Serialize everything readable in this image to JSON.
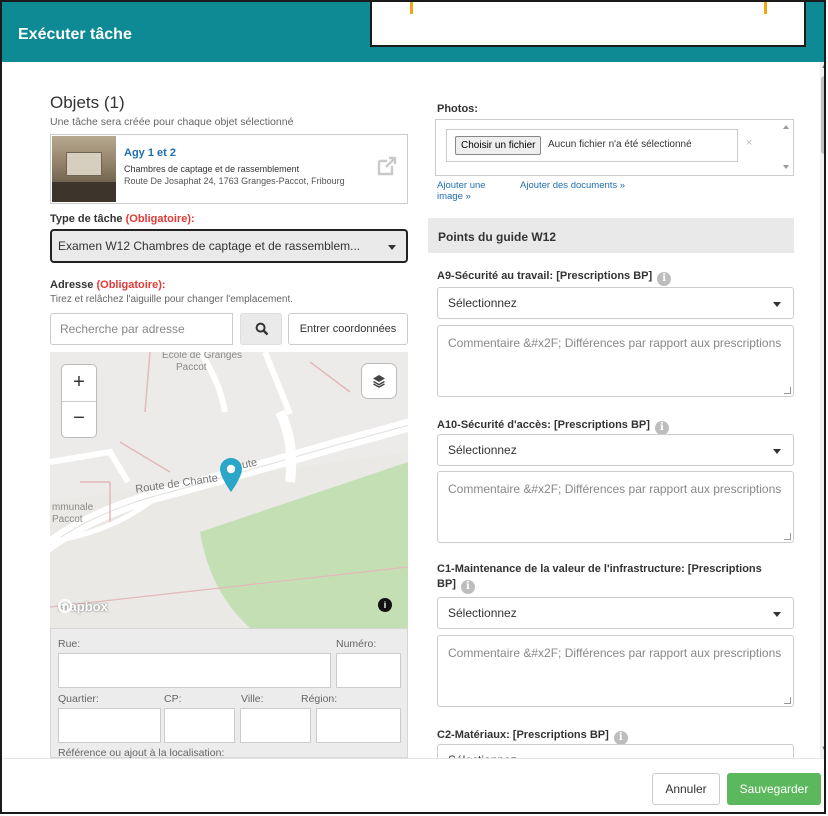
{
  "dialog": {
    "title": "Exécuter tâche"
  },
  "objects": {
    "heading": "Objets (1)",
    "subtitle": "Une tâche sera créée pour chaque objet sélectionné",
    "item": {
      "name": "Agy 1 et 2",
      "type": "Chambres de captage et de rassemblement",
      "address": "Route De Josaphat 24, 1763 Granges-Paccot, Fribourg"
    }
  },
  "task_type": {
    "label": "Type de tâche",
    "required": "(Obligatoire):",
    "selected": "Examen W12 Chambres de captage et de rassemblem..."
  },
  "address": {
    "label": "Adresse",
    "required": "(Obligatoire):",
    "hint": "Tirez et relâchez l'aiguille pour changer l'emplacement.",
    "search_placeholder": "Recherche par adresse",
    "coords_button": "Entrer coordonnées"
  },
  "map": {
    "labels": {
      "school_line1": "Ecole de Granges",
      "school_line2": "Paccot",
      "road": "Route de Chante",
      "road_end": "ute",
      "left_line1": "mmunale",
      "left_line2": "Paccot"
    },
    "attribution": "mapbox",
    "zoom_in": "+",
    "zoom_out": "−",
    "info": "i",
    "marker_color": "#2aa6c9"
  },
  "address_form": {
    "rue": "Rue:",
    "numero": "Numéro:",
    "quartier": "Quartier:",
    "cp": "CP:",
    "ville": "Ville:",
    "region": "Région:",
    "reference": "Référence ou ajout à la localisation:"
  },
  "photos": {
    "label": "Photos:",
    "choose_button": "Choisir un fichier",
    "no_file": "Aucun fichier n'a été sélectionné",
    "clear": "×",
    "add_image_line1": "Ajouter une",
    "add_image_line2": "image »",
    "add_docs": "Ajouter des documents »"
  },
  "guide": {
    "heading": "Points du guide W12",
    "questions": [
      {
        "label": "A9-Sécurité au travail: [Prescriptions BP]",
        "select": "Sélectionnez",
        "comment_placeholder": "Commentaire &#x2F; Différences par rapport aux prescriptions"
      },
      {
        "label": "A10-Sécurité d'accès: [Prescriptions BP]",
        "select": "Sélectionnez",
        "comment_placeholder": "Commentaire &#x2F; Différences par rapport aux prescriptions"
      },
      {
        "label_line1": "C1-Maintenance de la valeur de l'infrastructure: [Prescriptions",
        "label_line2": "BP]",
        "select": "Sélectionnez",
        "comment_placeholder": "Commentaire &#x2F; Différences par rapport aux prescriptions"
      },
      {
        "label": "C2-Matériaux: [Prescriptions BP]",
        "select": "Sélectionnez"
      }
    ]
  },
  "footer": {
    "cancel": "Annuler",
    "save": "Sauvegarder"
  },
  "colors": {
    "header": "#0e8a94",
    "save": "#5cb85c",
    "link": "#1f6fb2",
    "required": "#e53935"
  }
}
